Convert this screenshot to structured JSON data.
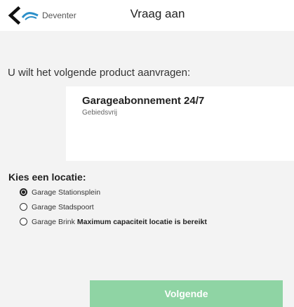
{
  "header": {
    "back_label": "Deventer",
    "title": "Vraag aan",
    "logo_icon": "deventer-logo-icon",
    "back_icon": "chevron-left-icon"
  },
  "intro": "U wilt het volgende product aanvragen:",
  "product": {
    "name": "Garageabonnement 24/7",
    "subtitle": "Gebiedsvrij"
  },
  "location": {
    "heading": "Kies een locatie:",
    "options": [
      {
        "label": "Garage Stationsplein",
        "selected": true,
        "note": ""
      },
      {
        "label": "Garage Stadspoort",
        "selected": false,
        "note": ""
      },
      {
        "label": "Garage Brink",
        "selected": false,
        "note": "Maximum capaciteit locatie is bereikt"
      }
    ]
  },
  "next_button": "Volgende",
  "colors": {
    "button": "#8fd4a4",
    "background": "#f3f3f3",
    "logo_blue": "#2b8fc9"
  }
}
